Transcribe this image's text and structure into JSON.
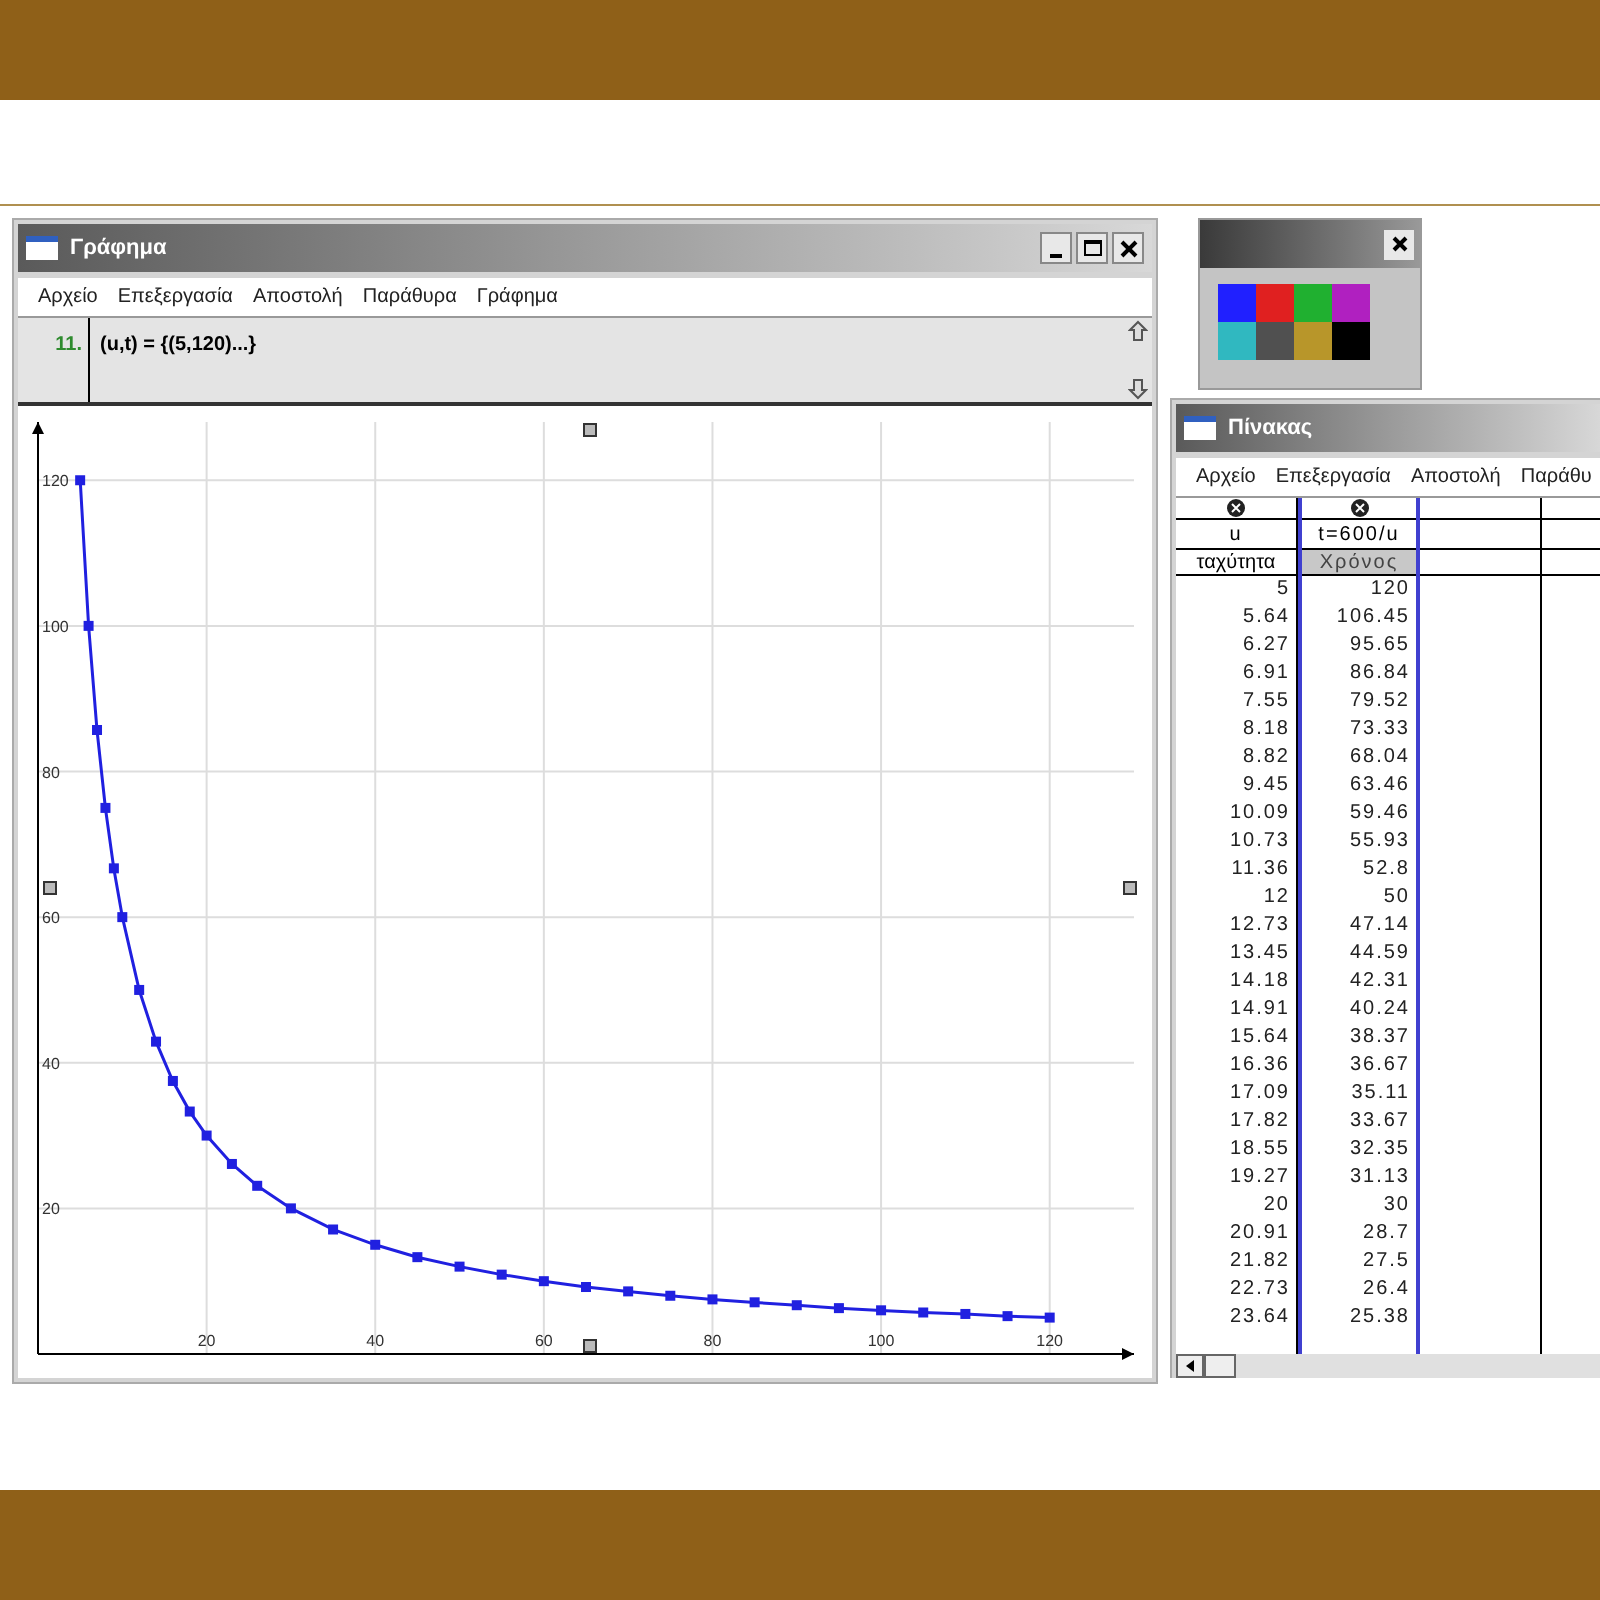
{
  "graph_window": {
    "title": "Γράφημα",
    "menu": [
      "Αρχείο",
      "Επεξεργασία",
      "Αποστολή",
      "Παράθυρα",
      "Γράφημα"
    ],
    "expression": {
      "number": "11.",
      "text": "(u,t) = {(5,120)...}"
    },
    "chart_data": {
      "type": "line",
      "x": [
        5,
        6,
        7,
        8,
        9,
        10,
        12,
        14,
        16,
        18,
        20,
        23,
        26,
        30,
        35,
        40,
        45,
        50,
        55,
        60,
        65,
        70,
        75,
        80,
        85,
        90,
        95,
        100,
        105,
        110,
        115,
        120
      ],
      "series": [
        {
          "color": "#2020e0",
          "marker": "square",
          "values": [
            120,
            100,
            85.7,
            75,
            66.7,
            60,
            50,
            42.9,
            37.5,
            33.3,
            30,
            26.1,
            23.1,
            20,
            17.1,
            15,
            13.3,
            12,
            10.9,
            10,
            9.2,
            8.6,
            8,
            7.5,
            7.1,
            6.7,
            6.3,
            6,
            5.7,
            5.5,
            5.2,
            5
          ]
        }
      ],
      "xlim": [
        0,
        130
      ],
      "ylim": [
        0,
        128
      ],
      "grid": true,
      "xticks": [
        20,
        40,
        60,
        80,
        100,
        120
      ],
      "yticks": [
        20,
        40,
        60,
        80,
        100,
        120
      ]
    }
  },
  "palette": {
    "colors": [
      {
        "color": "#2020ff"
      },
      {
        "color": "#e02020"
      },
      {
        "color": "#20b030"
      },
      {
        "color": "#b020c0"
      },
      {
        "color": "#30b8c0"
      },
      {
        "color": "#505050"
      },
      {
        "color": "#b8962a"
      },
      {
        "color": "#000000"
      }
    ]
  },
  "table_window": {
    "title": "Πίνακας",
    "menu": [
      "Αρχείο",
      "Επεξεργασία",
      "Αποστολή",
      "Παράθυ"
    ],
    "columns": [
      {
        "name": "u",
        "label": "ταχύτητα",
        "selected": false
      },
      {
        "name": "t=600/u",
        "label": "Χρόνος",
        "selected": true
      }
    ],
    "rows": [
      [
        "5",
        "120"
      ],
      [
        "5.64",
        "106.45"
      ],
      [
        "6.27",
        "95.65"
      ],
      [
        "6.91",
        "86.84"
      ],
      [
        "7.55",
        "79.52"
      ],
      [
        "8.18",
        "73.33"
      ],
      [
        "8.82",
        "68.04"
      ],
      [
        "9.45",
        "63.46"
      ],
      [
        "10.09",
        "59.46"
      ],
      [
        "10.73",
        "55.93"
      ],
      [
        "11.36",
        "52.8"
      ],
      [
        "12",
        "50"
      ],
      [
        "12.73",
        "47.14"
      ],
      [
        "13.45",
        "44.59"
      ],
      [
        "14.18",
        "42.31"
      ],
      [
        "14.91",
        "40.24"
      ],
      [
        "15.64",
        "38.37"
      ],
      [
        "16.36",
        "36.67"
      ],
      [
        "17.09",
        "35.11"
      ],
      [
        "17.82",
        "33.67"
      ],
      [
        "18.55",
        "32.35"
      ],
      [
        "19.27",
        "31.13"
      ],
      [
        "20",
        "30"
      ],
      [
        "20.91",
        "28.7"
      ],
      [
        "21.82",
        "27.5"
      ],
      [
        "22.73",
        "26.4"
      ],
      [
        "23.64",
        "25.38"
      ]
    ]
  }
}
